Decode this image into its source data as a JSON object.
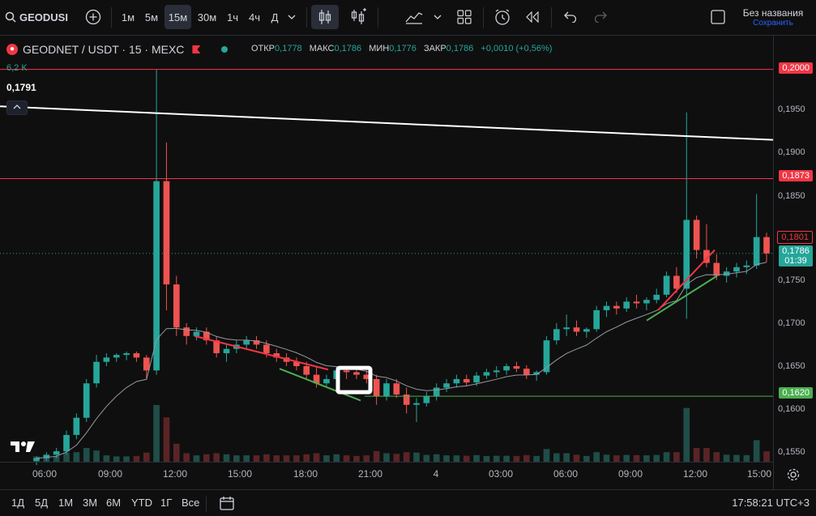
{
  "toolbar": {
    "symbol_input": "GEODUSI",
    "add_symbol": "+",
    "intervals": [
      "1м",
      "5м",
      "15м",
      "30м",
      "1ч",
      "4ч",
      "Д"
    ],
    "active_interval": "15м",
    "layout_name": "Без названия",
    "save_label": "Сохранить",
    "icons": [
      "add-icon",
      "candles-icon",
      "indicators-icon",
      "chart-type-icon",
      "templates-icon",
      "alert-icon",
      "replay-icon",
      "undo-icon",
      "redo-icon",
      "layout-icon"
    ]
  },
  "legend": {
    "title": "GEODNET / USDT · 15 · MEXC",
    "open_label": "ОТКР",
    "open_value": "0,1778",
    "high_label": "МАКС",
    "high_value": "0,1786",
    "low_label": "МИН",
    "low_value": "0,1776",
    "close_label": "ЗАКР",
    "close_value": "0,1786",
    "change": "+0,0010 (+0,56%)",
    "volume": "6,2 K",
    "ma_value": "0,1791"
  },
  "price_scale": {
    "labels": [
      "0,1950",
      "0,1900",
      "0,1850",
      "0,1750",
      "0,1700",
      "0,1650",
      "0,1600",
      "0,1550"
    ],
    "tag_top": "0,2000",
    "tag_mid": "0,1873",
    "tag_ma": "0,1801",
    "tag_price": "0,1786",
    "tag_countdown": "01:39",
    "tag_low": "0,1620"
  },
  "time_scale": {
    "labels": [
      "06:00",
      "09:00",
      "12:00",
      "15:00",
      "18:00",
      "21:00",
      "4",
      "03:00",
      "06:00",
      "09:00",
      "12:00",
      "15:00"
    ]
  },
  "bottom": {
    "ranges": [
      "1Д",
      "5Д",
      "1М",
      "3М",
      "6М",
      "YTD",
      "1Г",
      "Все"
    ],
    "clock": "17:58:21 UTC+3"
  },
  "colors": {
    "up": "#26a69a",
    "down": "#ef5350",
    "red_line": "#f23645",
    "green_line": "#4caf50"
  },
  "chart_data": {
    "type": "candlestick",
    "ylim": [
      0.1535,
      0.2025
    ],
    "candles": [
      [
        0.1545,
        0.155,
        0.154,
        0.1548
      ],
      [
        0.1548,
        0.1555,
        0.1545,
        0.1552
      ],
      [
        0.1552,
        0.156,
        0.1548,
        0.1556
      ],
      [
        0.1556,
        0.158,
        0.1552,
        0.1575
      ],
      [
        0.1575,
        0.16,
        0.157,
        0.1595
      ],
      [
        0.1595,
        0.164,
        0.159,
        0.1635
      ],
      [
        0.1635,
        0.1668,
        0.163,
        0.166
      ],
      [
        0.166,
        0.167,
        0.1655,
        0.1665
      ],
      [
        0.1665,
        0.167,
        0.166,
        0.1668
      ],
      [
        0.1668,
        0.1672,
        0.1662,
        0.167
      ],
      [
        0.167,
        0.1672,
        0.166,
        0.1665
      ],
      [
        0.1665,
        0.1668,
        0.164,
        0.165
      ],
      [
        0.165,
        0.2,
        0.1645,
        0.187
      ],
      [
        0.187,
        0.1915,
        0.172,
        0.175
      ],
      [
        0.175,
        0.176,
        0.169,
        0.17
      ],
      [
        0.17,
        0.1705,
        0.168,
        0.169
      ],
      [
        0.169,
        0.17,
        0.1685,
        0.1695
      ],
      [
        0.1695,
        0.17,
        0.168,
        0.1685
      ],
      [
        0.1685,
        0.169,
        0.1665,
        0.167
      ],
      [
        0.167,
        0.168,
        0.166,
        0.1675
      ],
      [
        0.1675,
        0.1685,
        0.167,
        0.168
      ],
      [
        0.168,
        0.169,
        0.1675,
        0.1685
      ],
      [
        0.1685,
        0.169,
        0.1675,
        0.168
      ],
      [
        0.168,
        0.1685,
        0.1665,
        0.167
      ],
      [
        0.167,
        0.1675,
        0.166,
        0.1665
      ],
      [
        0.1665,
        0.167,
        0.1655,
        0.166
      ],
      [
        0.166,
        0.1665,
        0.165,
        0.1655
      ],
      [
        0.1655,
        0.166,
        0.164,
        0.1645
      ],
      [
        0.1645,
        0.1655,
        0.163,
        0.1635
      ],
      [
        0.1635,
        0.1645,
        0.163,
        0.164
      ],
      [
        0.164,
        0.1655,
        0.1635,
        0.165
      ],
      [
        0.165,
        0.1655,
        0.164,
        0.1648
      ],
      [
        0.1648,
        0.1652,
        0.164,
        0.1645
      ],
      [
        0.1645,
        0.165,
        0.1635,
        0.164
      ],
      [
        0.164,
        0.1645,
        0.161,
        0.162
      ],
      [
        0.162,
        0.164,
        0.1615,
        0.1635
      ],
      [
        0.1635,
        0.164,
        0.1618,
        0.1622
      ],
      [
        0.1622,
        0.163,
        0.16,
        0.161
      ],
      [
        0.161,
        0.1618,
        0.159,
        0.1612
      ],
      [
        0.1612,
        0.1625,
        0.1608,
        0.162
      ],
      [
        0.162,
        0.1635,
        0.1615,
        0.163
      ],
      [
        0.163,
        0.164,
        0.1625,
        0.1635
      ],
      [
        0.1635,
        0.1645,
        0.163,
        0.164
      ],
      [
        0.164,
        0.1645,
        0.1632,
        0.1636
      ],
      [
        0.1636,
        0.1648,
        0.1632,
        0.1644
      ],
      [
        0.1644,
        0.1652,
        0.164,
        0.1648
      ],
      [
        0.1648,
        0.1655,
        0.1642,
        0.165
      ],
      [
        0.165,
        0.1658,
        0.1645,
        0.1655
      ],
      [
        0.1655,
        0.166,
        0.1648,
        0.1652
      ],
      [
        0.1652,
        0.1656,
        0.164,
        0.1645
      ],
      [
        0.1645,
        0.165,
        0.1638,
        0.1648
      ],
      [
        0.1648,
        0.169,
        0.1645,
        0.1685
      ],
      [
        0.1685,
        0.1705,
        0.168,
        0.1698
      ],
      [
        0.1698,
        0.1715,
        0.169,
        0.17
      ],
      [
        0.17,
        0.1708,
        0.169,
        0.1695
      ],
      [
        0.1695,
        0.17,
        0.1688,
        0.1698
      ],
      [
        0.1698,
        0.1725,
        0.1695,
        0.172
      ],
      [
        0.172,
        0.173,
        0.1712,
        0.1725
      ],
      [
        0.1725,
        0.173,
        0.1715,
        0.1722
      ],
      [
        0.1722,
        0.1735,
        0.1718,
        0.173
      ],
      [
        0.173,
        0.1738,
        0.1722,
        0.1728
      ],
      [
        0.1728,
        0.1735,
        0.172,
        0.1732
      ],
      [
        0.1732,
        0.1745,
        0.1728,
        0.1738
      ],
      [
        0.1738,
        0.1765,
        0.1735,
        0.176
      ],
      [
        0.176,
        0.177,
        0.174,
        0.1745
      ],
      [
        0.1745,
        0.195,
        0.171,
        0.1825
      ],
      [
        0.1825,
        0.183,
        0.178,
        0.179
      ],
      [
        0.179,
        0.182,
        0.177,
        0.1775
      ],
      [
        0.1775,
        0.1785,
        0.1755,
        0.176
      ],
      [
        0.176,
        0.177,
        0.1752,
        0.1765
      ],
      [
        0.1765,
        0.1775,
        0.1758,
        0.177
      ],
      [
        0.177,
        0.1778,
        0.1762,
        0.1772
      ],
      [
        0.1772,
        0.1855,
        0.1768,
        0.1805
      ],
      [
        0.1805,
        0.181,
        0.1776,
        0.1786
      ]
    ]
  }
}
